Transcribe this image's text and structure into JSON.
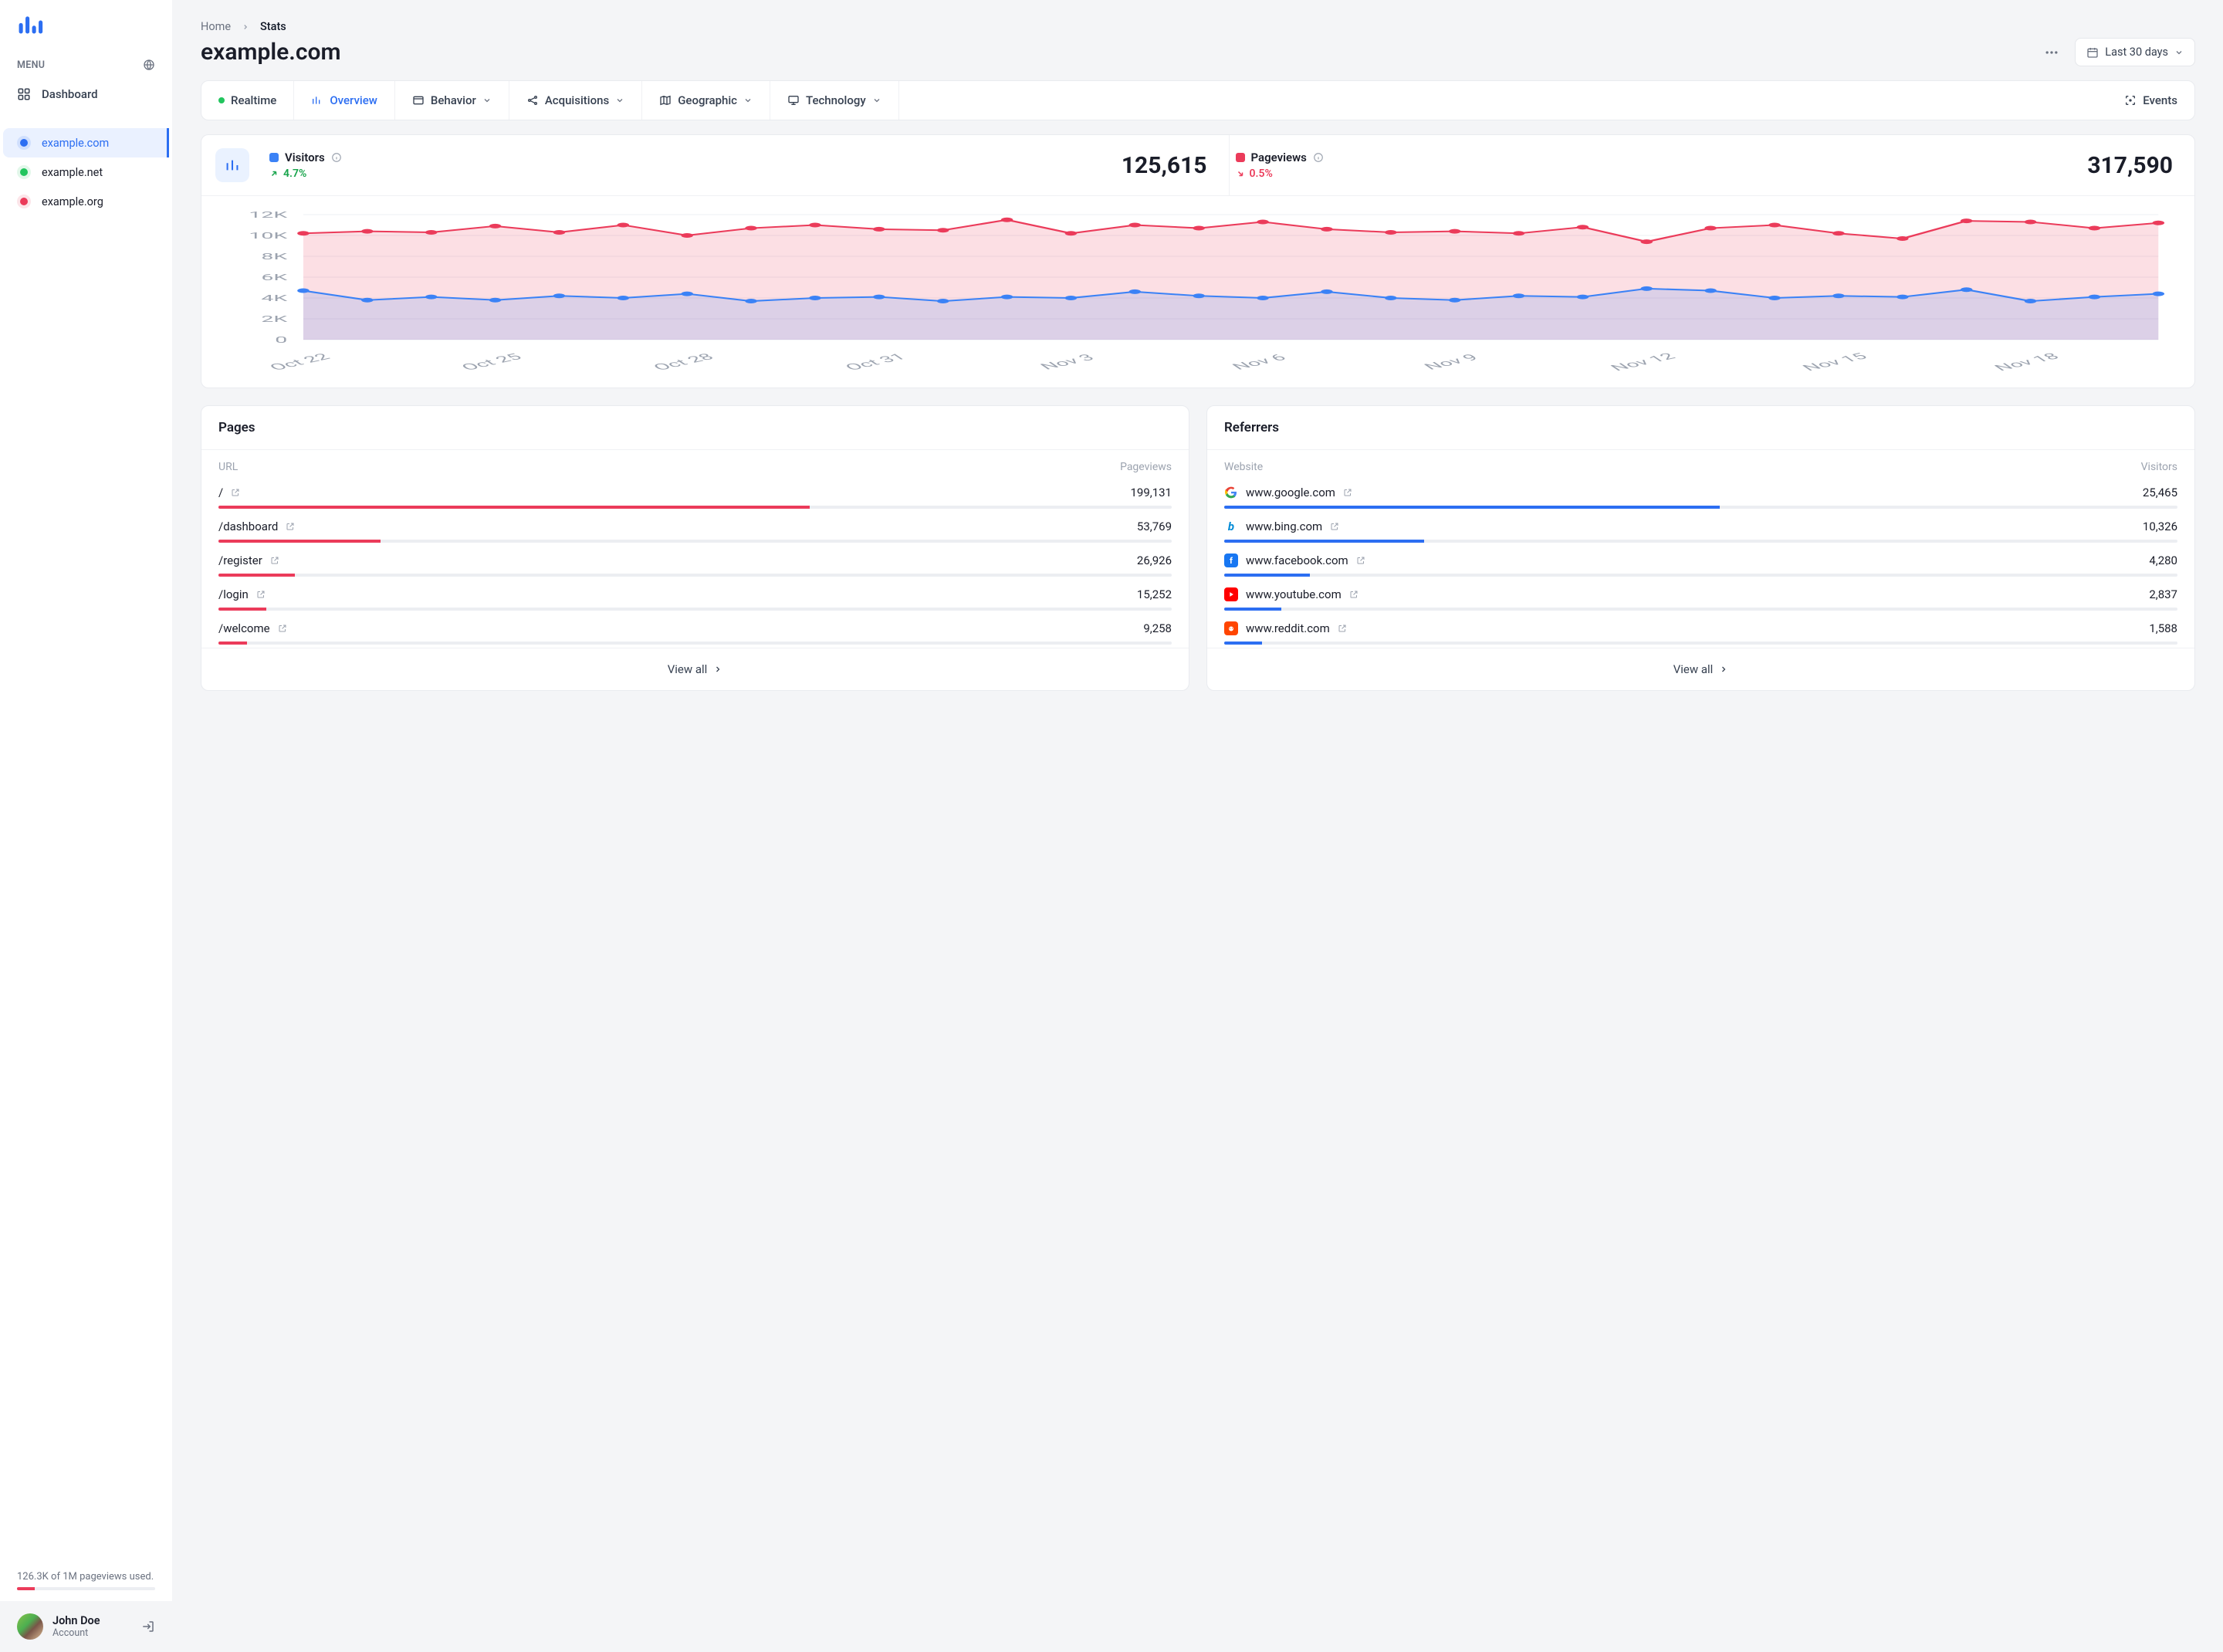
{
  "sidebar": {
    "menu_label": "MENU",
    "dashboard_label": "Dashboard",
    "sites": [
      {
        "name": "example.com",
        "color": "#2c6ef2",
        "active": true
      },
      {
        "name": "example.net",
        "color": "#22c55e",
        "active": false
      },
      {
        "name": "example.org",
        "color": "#eb3b5a",
        "active": false
      }
    ],
    "usage_text": "126.3K of 1M pageviews used.",
    "usage_pct": 13,
    "account": {
      "name": "John Doe",
      "sub": "Account"
    }
  },
  "breadcrumb": {
    "home": "Home",
    "current": "Stats"
  },
  "page_title": "example.com",
  "date_range_label": "Last 30 days",
  "tabs": {
    "realtime": "Realtime",
    "overview": "Overview",
    "behavior": "Behavior",
    "acquisitions": "Acquisitions",
    "geographic": "Geographic",
    "technology": "Technology",
    "events": "Events"
  },
  "metrics": {
    "visitors": {
      "label": "Visitors",
      "change": "4.7%",
      "direction": "up",
      "value": "125,615",
      "color": "#3b82f6"
    },
    "pageviews": {
      "label": "Pageviews",
      "change": "0.5%",
      "direction": "down",
      "value": "317,590",
      "color": "#eb3b5a"
    }
  },
  "chart_data": {
    "type": "line",
    "ylabel": "",
    "xlabel": "",
    "ylim": [
      0,
      12000
    ],
    "yticks": [
      "0",
      "2K",
      "4K",
      "6K",
      "8K",
      "10K",
      "12K"
    ],
    "x_labels_shown": [
      "Oct 22",
      "Oct 25",
      "Oct 28",
      "Oct 31",
      "Nov 3",
      "Nov 6",
      "Nov 9",
      "Nov 12",
      "Nov 15",
      "Nov 18"
    ],
    "categories": [
      "Oct 22",
      "Oct 23",
      "Oct 24",
      "Oct 25",
      "Oct 26",
      "Oct 27",
      "Oct 28",
      "Oct 29",
      "Oct 30",
      "Oct 31",
      "Nov 1",
      "Nov 2",
      "Nov 3",
      "Nov 4",
      "Nov 5",
      "Nov 6",
      "Nov 7",
      "Nov 8",
      "Nov 9",
      "Nov 10",
      "Nov 11",
      "Nov 12",
      "Nov 13",
      "Nov 14",
      "Nov 15",
      "Nov 16",
      "Nov 17",
      "Nov 18",
      "Nov 19",
      "Nov 20"
    ],
    "series": [
      {
        "name": "Pageviews",
        "color": "#eb3b5a",
        "values": [
          10200,
          10400,
          10300,
          10900,
          10300,
          11000,
          10000,
          10700,
          11000,
          10600,
          10500,
          11500,
          10200,
          11000,
          10700,
          11300,
          10600,
          10300,
          10400,
          10200,
          10800,
          9400,
          10700,
          11000,
          10200,
          9700,
          11400,
          11300,
          10700,
          11200
        ]
      },
      {
        "name": "Visitors",
        "color": "#3b82f6",
        "values": [
          4700,
          3800,
          4100,
          3800,
          4200,
          4000,
          4400,
          3700,
          4000,
          4100,
          3700,
          4100,
          4000,
          4600,
          4200,
          4000,
          4600,
          4000,
          3800,
          4200,
          4100,
          4900,
          4700,
          4000,
          4200,
          4100,
          4800,
          3700,
          4100,
          4400
        ]
      }
    ]
  },
  "pages_table": {
    "title": "Pages",
    "col_left": "URL",
    "col_right": "Pageviews",
    "rows": [
      {
        "url": "/",
        "pageviews": "199,131",
        "pct": 62
      },
      {
        "url": "/dashboard",
        "pageviews": "53,769",
        "pct": 17
      },
      {
        "url": "/register",
        "pageviews": "26,926",
        "pct": 8
      },
      {
        "url": "/login",
        "pageviews": "15,252",
        "pct": 5
      },
      {
        "url": "/welcome",
        "pageviews": "9,258",
        "pct": 3
      }
    ],
    "view_all": "View all"
  },
  "referrers_table": {
    "title": "Referrers",
    "col_left": "Website",
    "col_right": "Visitors",
    "rows": [
      {
        "site": "www.google.com",
        "visitors": "25,465",
        "pct": 52,
        "icon": "google"
      },
      {
        "site": "www.bing.com",
        "visitors": "10,326",
        "pct": 21,
        "icon": "bing"
      },
      {
        "site": "www.facebook.com",
        "visitors": "4,280",
        "pct": 9,
        "icon": "facebook"
      },
      {
        "site": "www.youtube.com",
        "visitors": "2,837",
        "pct": 6,
        "icon": "youtube"
      },
      {
        "site": "www.reddit.com",
        "visitors": "1,588",
        "pct": 4,
        "icon": "reddit"
      }
    ],
    "view_all": "View all"
  }
}
